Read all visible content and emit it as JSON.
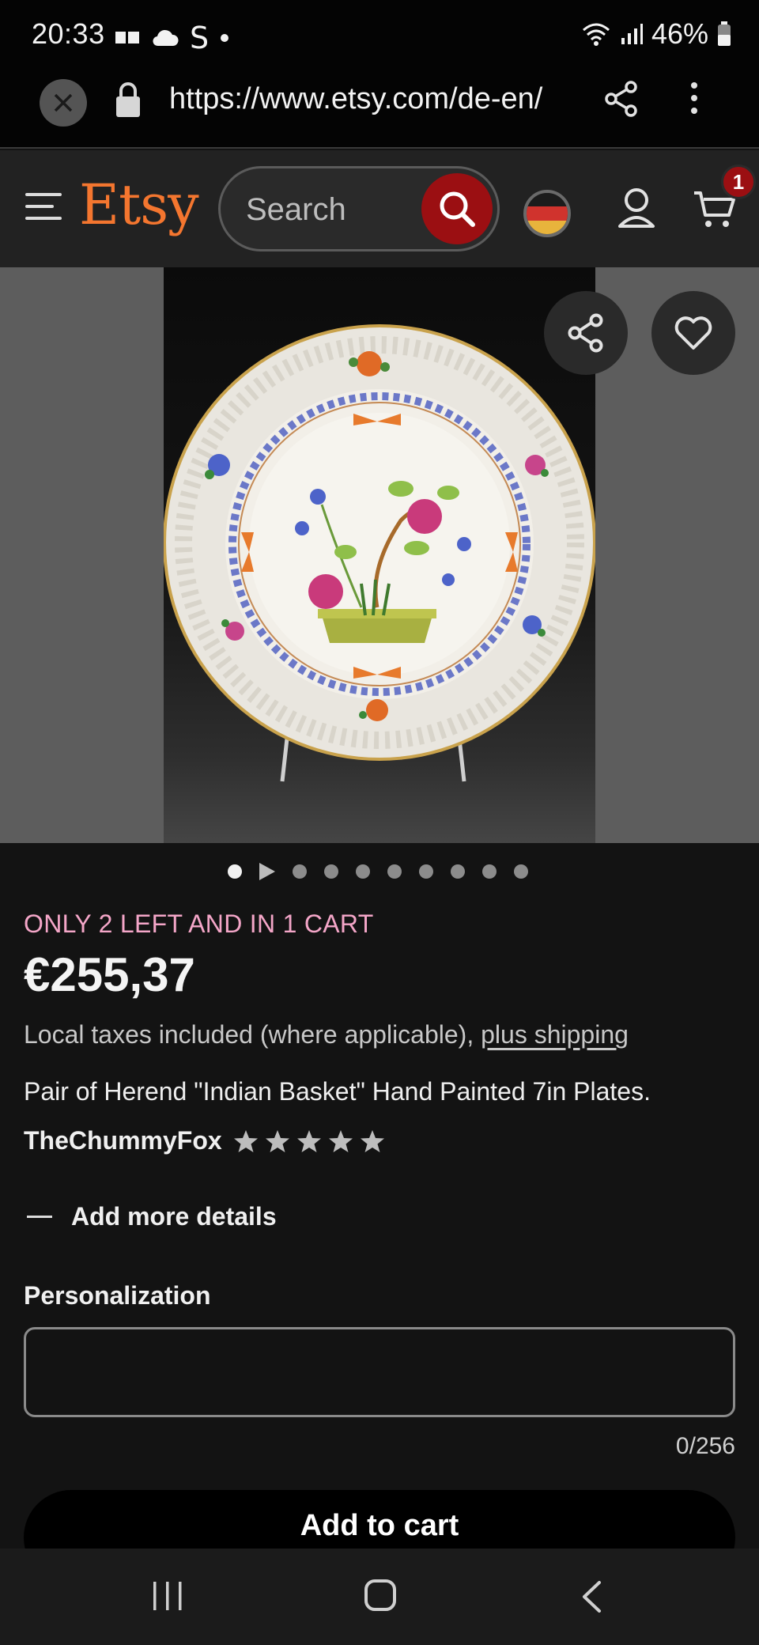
{
  "status_bar": {
    "time": "20:33",
    "left_icons": [
      "newspaper-icon",
      "cloud-icon",
      "s-app-icon",
      "dot-icon"
    ],
    "s_glyph": "S",
    "battery_text": "46%",
    "right_icons": [
      "wifi-icon",
      "signal-icon",
      "battery-icon"
    ]
  },
  "browser": {
    "url": "https://www.etsy.com/de-en/",
    "icons": [
      "close-icon",
      "lock-icon",
      "share-icon",
      "more-vert-icon"
    ]
  },
  "header": {
    "logo": "Etsy",
    "search_placeholder": "Search",
    "cart_count": "1",
    "icons": [
      "menu-icon",
      "search-icon",
      "germany-flag-icon",
      "user-icon",
      "cart-icon"
    ],
    "colors": {
      "logo": "#f4762f",
      "search_button": "#9b0f12",
      "badge": "#9b0f12"
    }
  },
  "gallery": {
    "icons": [
      "share-icon",
      "heart-icon"
    ],
    "dot_count": 10,
    "active_index": 0
  },
  "product": {
    "stock_notice": "ONLY 2 LEFT AND IN 1 CART",
    "price": "€255,37",
    "taxes_text": "Local taxes included (where applicable), ",
    "shipping_link": "plus shipping",
    "title": "Pair of Herend \"Indian Basket\" Hand Painted 7in Plates.",
    "shop_name": "TheChummyFox",
    "rating_stars": 5,
    "details_label": "Add more details",
    "personalization_label": "Personalization",
    "personalization_value": "",
    "char_count": "0/256",
    "add_to_cart": "Add to cart",
    "colors": {
      "stock_notice": "#f4a6c8"
    }
  },
  "navbar": {
    "icons": [
      "recents-icon",
      "home-icon",
      "back-icon"
    ]
  }
}
